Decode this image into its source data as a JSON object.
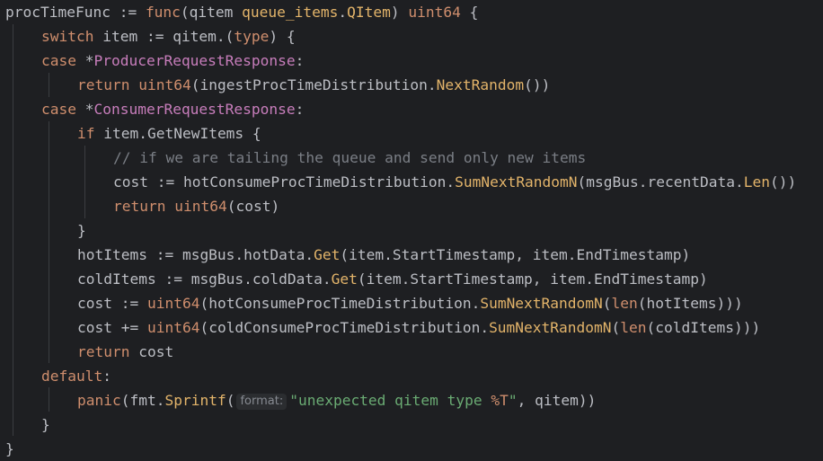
{
  "editor": {
    "language": "Go",
    "colors": {
      "background": "#1e1f22",
      "default": "#bcbec4",
      "keyword": "#cf8e6d",
      "function": "#56a8f5",
      "type": "#c77dbb",
      "method": "#e3b46a",
      "comment": "#7a7e85",
      "string": "#6aab73"
    },
    "lines": [
      {
        "tokens": [
          [
            "ph",
            "procTimeFunc := "
          ],
          [
            "kw",
            "func"
          ],
          [
            "ph",
            "("
          ],
          [
            "ph",
            "qitem "
          ],
          [
            "gold",
            "queue_items"
          ],
          [
            "ph",
            "."
          ],
          [
            "gold",
            "QItem"
          ],
          [
            "ph",
            ") "
          ],
          [
            "kw",
            "uint64"
          ],
          [
            "ph",
            " {"
          ]
        ]
      },
      {
        "tokens": [
          [
            "kw",
            "switch"
          ],
          [
            "ph",
            " item := qitem.("
          ],
          [
            "kw",
            "type"
          ],
          [
            "ph",
            ") {"
          ]
        ]
      },
      {
        "tokens": [
          [
            "kw",
            "case"
          ],
          [
            "ph",
            " *"
          ],
          [
            "ty",
            "ProducerRequestResponse"
          ],
          [
            "ph",
            ":"
          ]
        ]
      },
      {
        "tokens": [
          [
            "kw",
            "return"
          ],
          [
            "ph",
            " "
          ],
          [
            "kw",
            "uint64"
          ],
          [
            "ph",
            "(ingestProcTimeDistribution."
          ],
          [
            "gold",
            "NextRandom"
          ],
          [
            "ph",
            "())"
          ]
        ]
      },
      {
        "tokens": [
          [
            "kw",
            "case"
          ],
          [
            "ph",
            " *"
          ],
          [
            "ty",
            "ConsumerRequestResponse"
          ],
          [
            "ph",
            ":"
          ]
        ]
      },
      {
        "tokens": [
          [
            "kw",
            "if"
          ],
          [
            "ph",
            " item.GetNewItems {"
          ]
        ]
      },
      {
        "tokens": [
          [
            "cm",
            "// if we are tailing the queue and send only new items"
          ]
        ]
      },
      {
        "tokens": [
          [
            "ph",
            "cost := hotConsumeProcTimeDistribution."
          ],
          [
            "gold",
            "SumNextRandomN"
          ],
          [
            "ph",
            "(msgBus.recentData."
          ],
          [
            "gold",
            "Len"
          ],
          [
            "ph",
            "())"
          ]
        ]
      },
      {
        "tokens": [
          [
            "kw",
            "return"
          ],
          [
            "ph",
            " "
          ],
          [
            "kw",
            "uint64"
          ],
          [
            "ph",
            "(cost)"
          ]
        ]
      },
      {
        "tokens": [
          [
            "ph",
            "}"
          ]
        ]
      },
      {
        "tokens": [
          [
            "ph",
            "hotItems := msgBus.hotData."
          ],
          [
            "gold",
            "Get"
          ],
          [
            "ph",
            "(item.StartTimestamp, item.EndTimestamp)"
          ]
        ]
      },
      {
        "tokens": [
          [
            "ph",
            "coldItems := msgBus.coldData."
          ],
          [
            "gold",
            "Get"
          ],
          [
            "ph",
            "(item.StartTimestamp, item.EndTimestamp)"
          ]
        ]
      },
      {
        "tokens": [
          [
            "ph",
            "cost := "
          ],
          [
            "kw",
            "uint64"
          ],
          [
            "ph",
            "(hotConsumeProcTimeDistribution."
          ],
          [
            "gold",
            "SumNextRandomN"
          ],
          [
            "ph",
            "("
          ],
          [
            "kw",
            "len"
          ],
          [
            "ph",
            "(hotItems)))"
          ]
        ]
      },
      {
        "tokens": [
          [
            "ph",
            "cost += "
          ],
          [
            "kw",
            "uint64"
          ],
          [
            "ph",
            "(coldConsumeProcTimeDistribution."
          ],
          [
            "gold",
            "SumNextRandomN"
          ],
          [
            "ph",
            "("
          ],
          [
            "kw",
            "len"
          ],
          [
            "ph",
            "(coldItems)))"
          ]
        ]
      },
      {
        "tokens": [
          [
            "kw",
            "return"
          ],
          [
            "ph",
            " cost"
          ]
        ]
      },
      {
        "tokens": [
          [
            "kw",
            "default"
          ],
          [
            "ph",
            ":"
          ]
        ]
      },
      {
        "tokens": [
          [
            "kw",
            "panic"
          ],
          [
            "ph",
            "(fmt."
          ],
          [
            "gold",
            "Sprintf"
          ],
          [
            "ph",
            "("
          ],
          [
            "hint",
            "format:"
          ],
          [
            "str",
            "\"unexpected qitem type "
          ],
          [
            "esc",
            "%T"
          ],
          [
            "str",
            "\""
          ],
          [
            "ph",
            ", qitem))"
          ]
        ]
      },
      {
        "tokens": [
          [
            "ph",
            "}"
          ]
        ]
      },
      {
        "tokens": [
          [
            "ph",
            "}"
          ]
        ]
      }
    ]
  }
}
